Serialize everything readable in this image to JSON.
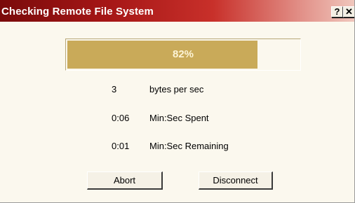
{
  "window": {
    "title": "Checking Remote File System",
    "help_label": "?",
    "close_label": "✕"
  },
  "progress": {
    "percent": 82,
    "label": "82%"
  },
  "stats": [
    {
      "value": "3",
      "label": "bytes per sec"
    },
    {
      "value": "0:06",
      "label": "Min:Sec Spent"
    },
    {
      "value": "0:01",
      "label": "Min:Sec Remaining"
    }
  ],
  "buttons": {
    "abort_label": "Abort",
    "disconnect_label": "Disconnect"
  },
  "colors": {
    "titlebar_start": "#7a0b0b",
    "titlebar_end": "#f0c7bd",
    "progress_fill": "#c9aa59",
    "dialog_background": "#fbf8ee"
  }
}
